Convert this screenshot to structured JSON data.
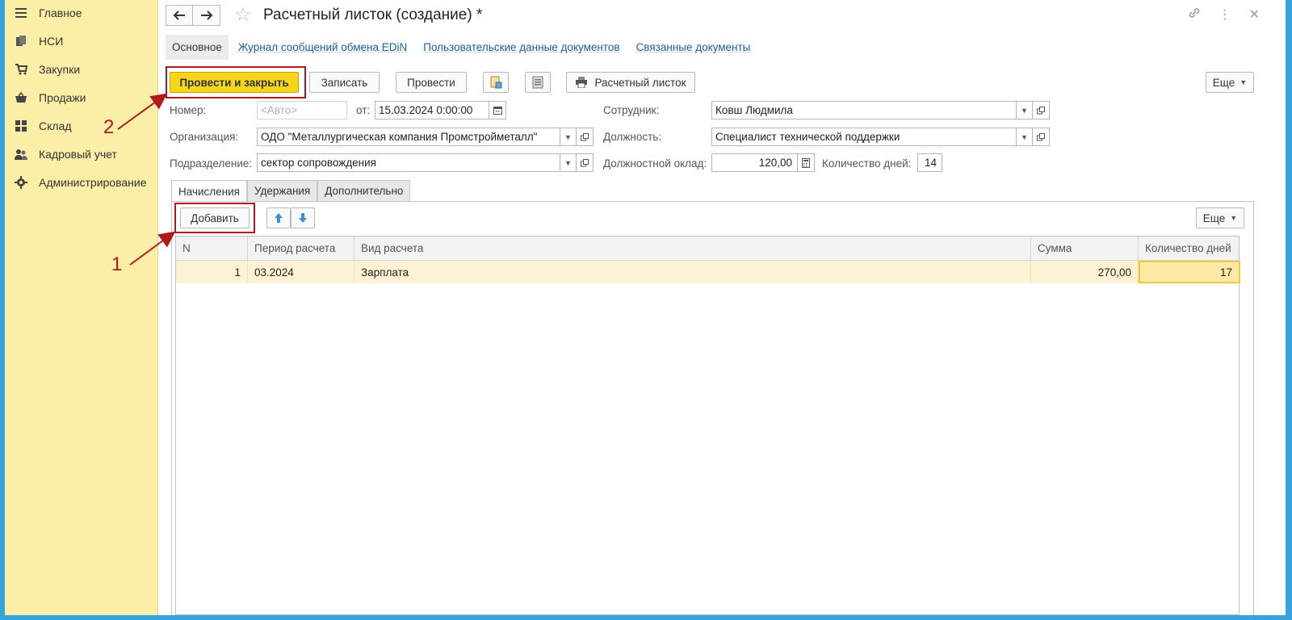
{
  "sidebar": {
    "items": [
      {
        "label": "Главное",
        "icon": "menu-lines-icon"
      },
      {
        "label": "НСИ",
        "icon": "documents-icon"
      },
      {
        "label": "Закупки",
        "icon": "cart-icon"
      },
      {
        "label": "Продажи",
        "icon": "basket-icon"
      },
      {
        "label": "Склад",
        "icon": "warehouse-grid-icon"
      },
      {
        "label": "Кадровый учет",
        "icon": "people-icon"
      },
      {
        "label": "Администрирование",
        "icon": "gear-icon"
      }
    ]
  },
  "header": {
    "title": "Расчетный листок (создание) *"
  },
  "nav_tabs": [
    {
      "label": "Основное",
      "active": true
    },
    {
      "label": "Журнал сообщений обмена EDiN"
    },
    {
      "label": "Пользовательские данные документов"
    },
    {
      "label": "Связанные документы"
    }
  ],
  "toolbar": {
    "post_close": "Провести и закрыть",
    "save": "Записать",
    "post": "Провести",
    "print_label": "Расчетный листок",
    "more": "Еще"
  },
  "form": {
    "number_label": "Номер:",
    "number_placeholder": "<Авто>",
    "date_label": "от:",
    "date_value": "15.03.2024  0:00:00",
    "org_label": "Организация:",
    "org_value": "ОДО \"Металлургическая компания Промстройметалл\"",
    "dept_label": "Подразделение:",
    "dept_value": "сектор сопровождения",
    "employee_label": "Сотрудник:",
    "employee_value": "Ковш Людмила",
    "position_label": "Должность:",
    "position_value": "Специалист технической поддержки",
    "salary_label": "Должностной оклад:",
    "salary_value": "120,00",
    "days_label": "Количество дней:",
    "days_value": "14"
  },
  "inner_tabs": [
    {
      "label": "Начисления",
      "active": true
    },
    {
      "label": "Удержания"
    },
    {
      "label": "Дополнительно"
    }
  ],
  "table_toolbar": {
    "add": "Добавить",
    "more": "Еще"
  },
  "table": {
    "columns": [
      "N",
      "Период расчета",
      "Вид расчета",
      "Сумма",
      "Количество дней"
    ],
    "rows": [
      {
        "n": "1",
        "period": "03.2024",
        "type": "Зарплата",
        "sum": "270,00",
        "days": "17"
      }
    ]
  },
  "annotations": {
    "one": "1",
    "two": "2"
  },
  "colors": {
    "sidebar_bg": "#fbeea6",
    "primary_button": "#f6d51b",
    "annotation_red": "#b01a1a",
    "frame_border": "#34a3de"
  }
}
